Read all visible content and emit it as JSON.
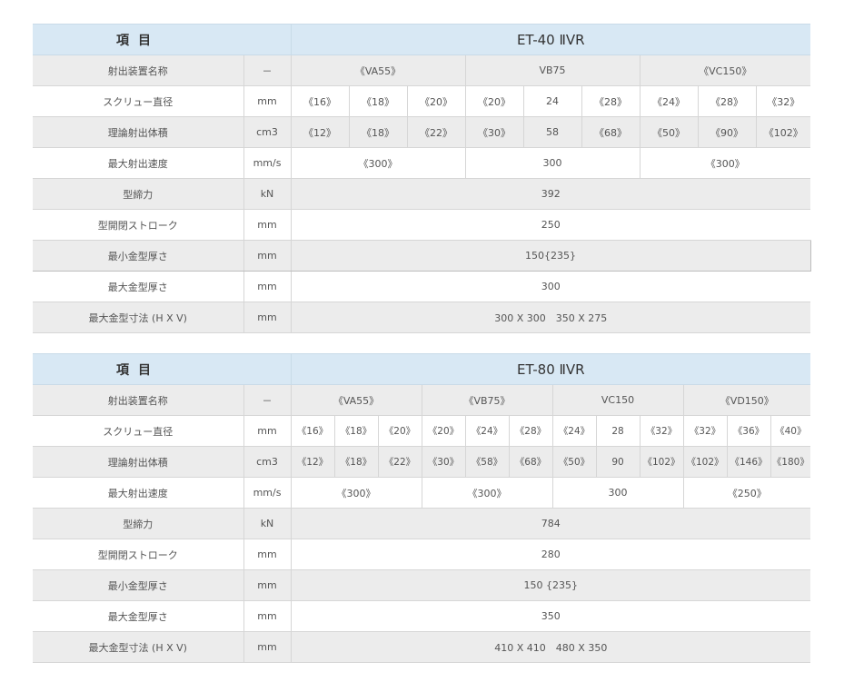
{
  "table1": {
    "item_header": "項目",
    "model": "ET-40 ⅡVR",
    "rows": {
      "injector": {
        "label": "射出装置名称",
        "unit": "－",
        "values": [
          "《VA55》",
          "VB75",
          "《VC150》"
        ]
      },
      "screw": {
        "label": "スクリュー直径",
        "unit": "mm",
        "values": [
          "《16》",
          "《18》",
          "《20》",
          "《20》",
          "24",
          "《28》",
          "《24》",
          "《28》",
          "《32》"
        ]
      },
      "volume": {
        "label": "理論射出体積",
        "unit": "cm3",
        "values": [
          "《12》",
          "《18》",
          "《22》",
          "《30》",
          "58",
          "《68》",
          "《50》",
          "《90》",
          "《102》"
        ]
      },
      "speed": {
        "label": "最大射出速度",
        "unit": "mm/s",
        "values": [
          "《300》",
          "300",
          "《300》"
        ]
      },
      "clamp": {
        "label": "型締力",
        "unit": "kN",
        "value": "392"
      },
      "stroke": {
        "label": "型開閉ストローク",
        "unit": "mm",
        "value": "250"
      },
      "min_mold": {
        "label": "最小金型厚さ",
        "unit": "mm",
        "value": "150{235}"
      },
      "max_mold": {
        "label": "最大金型厚さ",
        "unit": "mm",
        "value": "300"
      },
      "mold_size": {
        "label": "最大金型寸法 (H X V)",
        "unit": "mm",
        "value": "300 X 300　350 X 275"
      }
    }
  },
  "table2": {
    "item_header": "項目",
    "model": "ET-80 ⅡVR",
    "rows": {
      "injector": {
        "label": "射出装置名称",
        "unit": "－",
        "values": [
          "《VA55》",
          "《VB75》",
          "VC150",
          "《VD150》"
        ]
      },
      "screw": {
        "label": "スクリュー直径",
        "unit": "mm",
        "values": [
          "《16》",
          "《18》",
          "《20》",
          "《20》",
          "《24》",
          "《28》",
          "《24》",
          "28",
          "《32》",
          "《32》",
          "《36》",
          "《40》"
        ]
      },
      "volume": {
        "label": "理論射出体積",
        "unit": "cm3",
        "values": [
          "《12》",
          "《18》",
          "《22》",
          "《30》",
          "《58》",
          "《68》",
          "《50》",
          "90",
          "《102》",
          "《102》",
          "《146》",
          "《180》"
        ]
      },
      "speed": {
        "label": "最大射出速度",
        "unit": "mm/s",
        "values": [
          "《300》",
          "《300》",
          "300",
          "《250》"
        ]
      },
      "clamp": {
        "label": "型締力",
        "unit": "kN",
        "value": "784"
      },
      "stroke": {
        "label": "型開閉ストローク",
        "unit": "mm",
        "value": "280"
      },
      "min_mold": {
        "label": "最小金型厚さ",
        "unit": "mm",
        "value": "150 {235}"
      },
      "max_mold": {
        "label": "最大金型厚さ",
        "unit": "mm",
        "value": "350"
      },
      "mold_size": {
        "label": "最大金型寸法 (H X V)",
        "unit": "mm",
        "value": "410 X 410　480 X 350"
      }
    }
  }
}
